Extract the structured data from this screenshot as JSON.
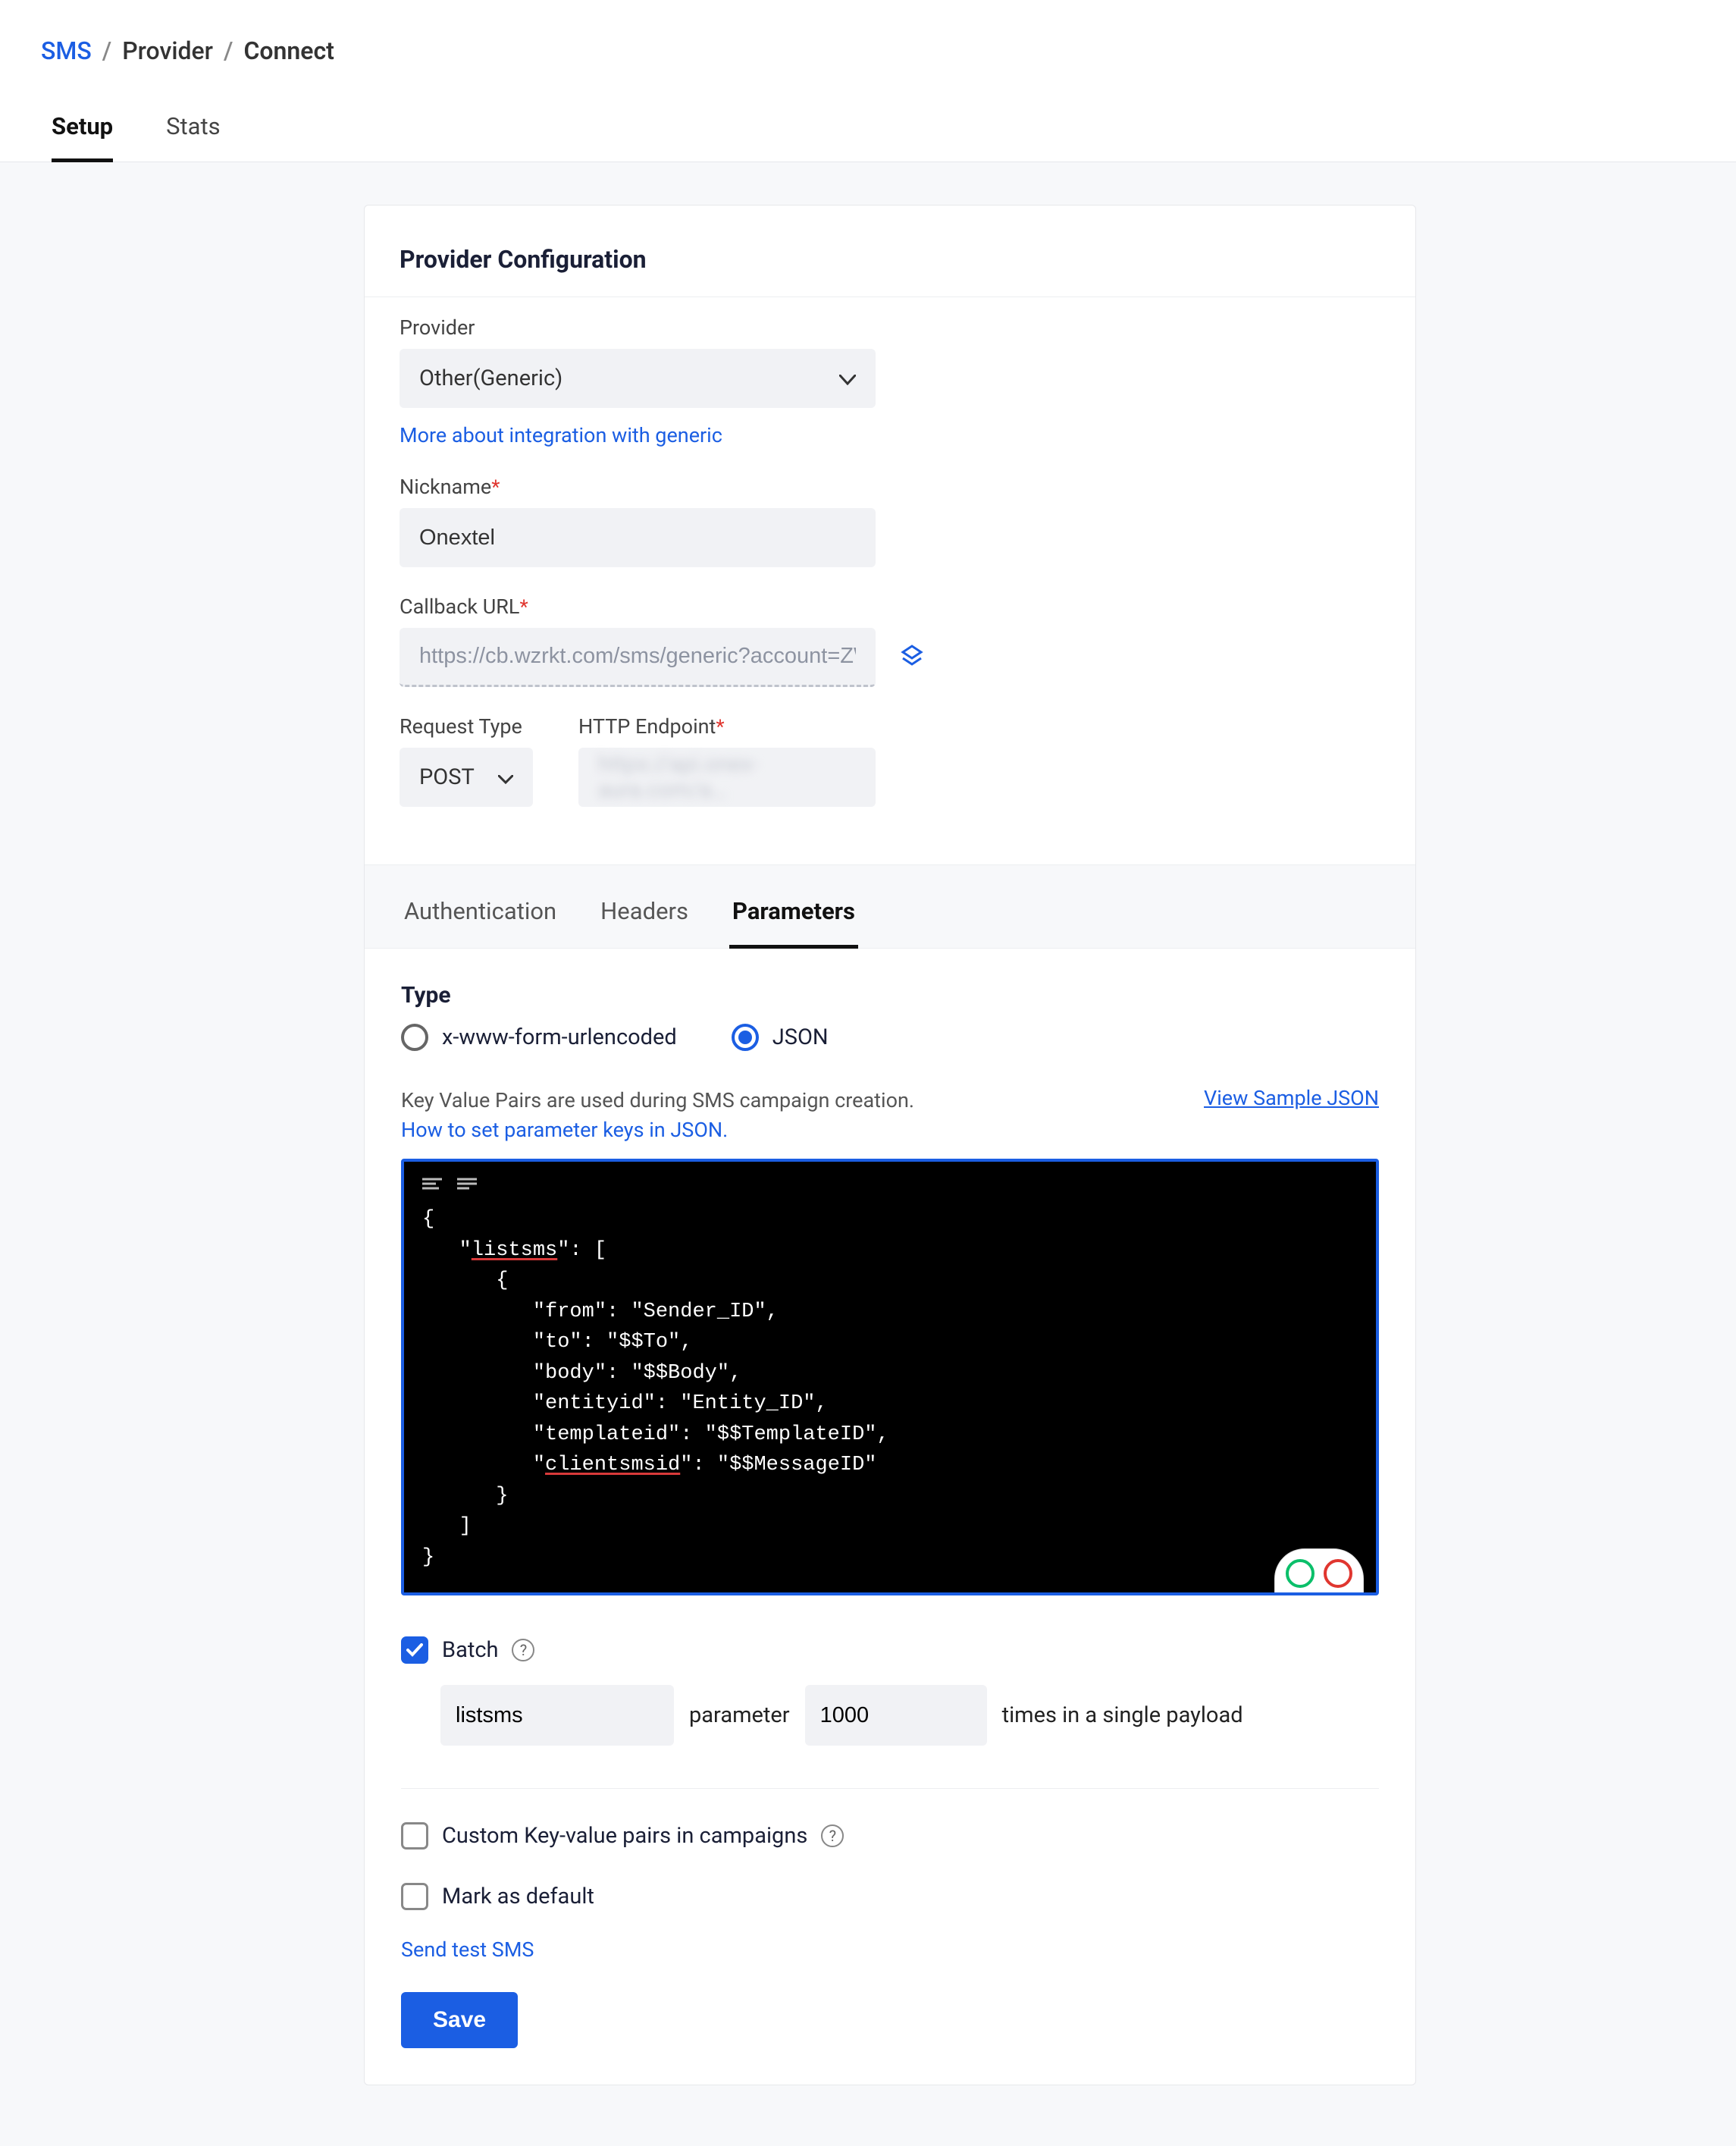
{
  "breadcrumb": {
    "a": "SMS",
    "b": "Provider",
    "c": "Connect"
  },
  "topTabs": {
    "setup": "Setup",
    "stats": "Stats"
  },
  "section": {
    "title": "Provider Configuration"
  },
  "form": {
    "provider_label": "Provider",
    "provider_value": "Other(Generic)",
    "provider_link": "More about integration with generic",
    "nickname_label": "Nickname",
    "nickname_value": "Onextel",
    "callback_label": "Callback URL",
    "callback_value": "https://cb.wzrkt.com/sms/generic?account=ZWW-…",
    "request_type_label": "Request Type",
    "request_type_value": "POST",
    "endpoint_label": "HTTP Endpoint",
    "endpoint_value": "https://api.onex-aura.com/a…"
  },
  "subTabs": {
    "auth": "Authentication",
    "headers": "Headers",
    "params": "Parameters"
  },
  "params": {
    "type_label": "Type",
    "radio_form": "x-www-form-urlencoded",
    "radio_json": "JSON",
    "help_prefix": "Key Value Pairs are used during SMS campaign creation. ",
    "help_link": "How to set parameter keys in JSON.",
    "view_sample": "View Sample JSON",
    "json_body": {
      "listsms": [
        {
          "from": "Sender_ID",
          "to": "$$To",
          "body": "$$Body",
          "entityid": "Entity_ID",
          "templateid": "$$TemplateID",
          "clientsmsid": "$$MessageID"
        }
      ]
    },
    "batch_label": "Batch",
    "batch_param": "listsms",
    "batch_word_parameter": "parameter",
    "batch_count": "1000",
    "batch_suffix": "times in a single payload",
    "custom_kv_label": "Custom Key-value pairs in campaigns",
    "mark_default_label": "Mark as default",
    "send_test": "Send test SMS",
    "save": "Save"
  }
}
